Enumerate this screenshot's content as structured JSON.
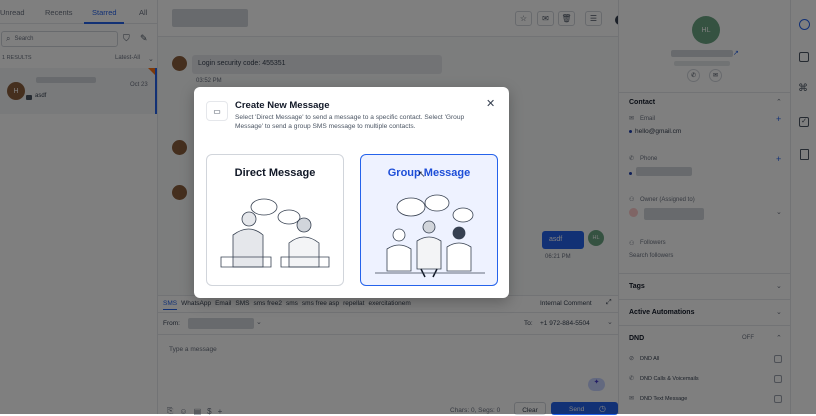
{
  "tabs": {
    "unread": "Unread",
    "recents": "Recents",
    "starred": "Starred",
    "all": "All"
  },
  "search": {
    "placeholder": "Search"
  },
  "results": {
    "count": "1 RESULTS",
    "sort": "Latest-All"
  },
  "conversation": {
    "avatar": "H",
    "preview": "asdf",
    "date": "Oct 23"
  },
  "messages": {
    "security": "Login security code: 455351",
    "time1": "03:52 PM",
    "outgoing": "asdf",
    "outgoing_avatar": "HL",
    "time2": "06:21 PM"
  },
  "composer": {
    "channels": [
      "SMS",
      "WhatsApp",
      "Email",
      "SMS",
      "sms free2",
      "sms",
      "sms free asp",
      "repellat",
      "exercitationem"
    ],
    "internal": "Internal Comment",
    "from_label": "From:",
    "to_label": "To:",
    "to_value": "+1 972-884-5504",
    "placeholder": "Type a message",
    "chars": "Chars: 0, Segs: 0",
    "clear": "Clear",
    "send": "Send"
  },
  "contact": {
    "avatar": "HL",
    "section": "Contact",
    "email_label": "Email",
    "email": "hello@gmail.cm",
    "phone_label": "Phone",
    "owner_label": "Owner (Assigned to)",
    "followers_label": "Followers",
    "followers_placeholder": "Search followers",
    "tags": "Tags",
    "automations": "Active Automations",
    "dnd": "DND",
    "dnd_state": "OFF",
    "dnd_items": [
      "DND All",
      "DND Calls & Voicemails",
      "DND Text Message"
    ]
  },
  "modal": {
    "title": "Create New Message",
    "desc": "Select 'Direct Message' to send a message to a specific contact. Select 'Group Message' to send a group SMS message to multiple contacts.",
    "direct": "Direct Message",
    "group": "Group Message"
  },
  "colors": {
    "accent": "#2563eb",
    "contact_avatar": "#6ba583",
    "conv_avatar": "#8b5e3c"
  }
}
